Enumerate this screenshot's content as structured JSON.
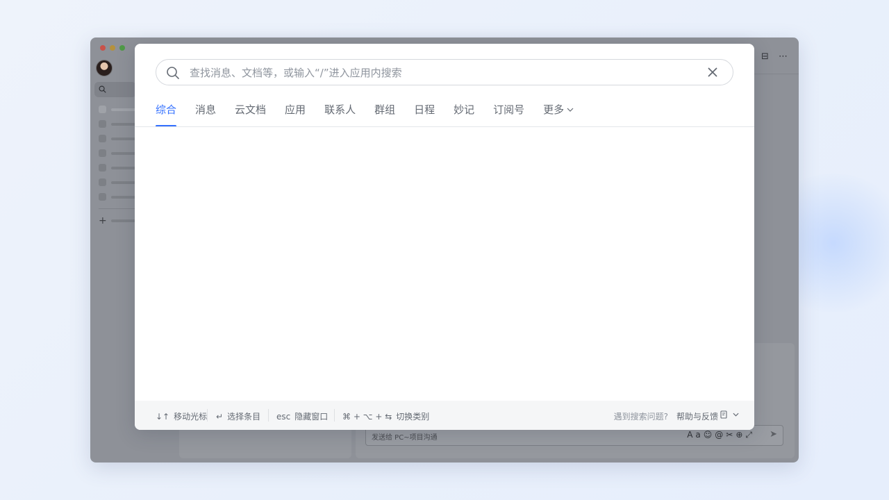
{
  "search": {
    "placeholder": "查找消息、文档等，或输入“/”进入应用内搜索"
  },
  "tabs": [
    {
      "label": "综合",
      "active": true
    },
    {
      "label": "消息"
    },
    {
      "label": "云文档"
    },
    {
      "label": "应用"
    },
    {
      "label": "联系人"
    },
    {
      "label": "群组"
    },
    {
      "label": "日程"
    },
    {
      "label": "妙记"
    },
    {
      "label": "订阅号"
    },
    {
      "label": "更多"
    }
  ],
  "footer": {
    "hint_move_key": "↓↑",
    "hint_move_label": "移动光标",
    "hint_select_key": "↵",
    "hint_select_label": "选择条目",
    "hint_esc_key": "esc",
    "hint_esc_label": "隐藏窗口",
    "hint_switch_key": "⌘ + ⌥ + ⇆",
    "hint_switch_label": "切换类别",
    "problem_text": "遇到搜索问题?",
    "help_label": "帮助与反馈"
  },
  "background": {
    "composer_placeholder": "发送给 PC~项目沟通"
  },
  "colors": {
    "accent": "#3370ff",
    "text_secondary": "#646a73",
    "text_placeholder": "#8f959e",
    "footer_bg": "#f5f6f7"
  }
}
